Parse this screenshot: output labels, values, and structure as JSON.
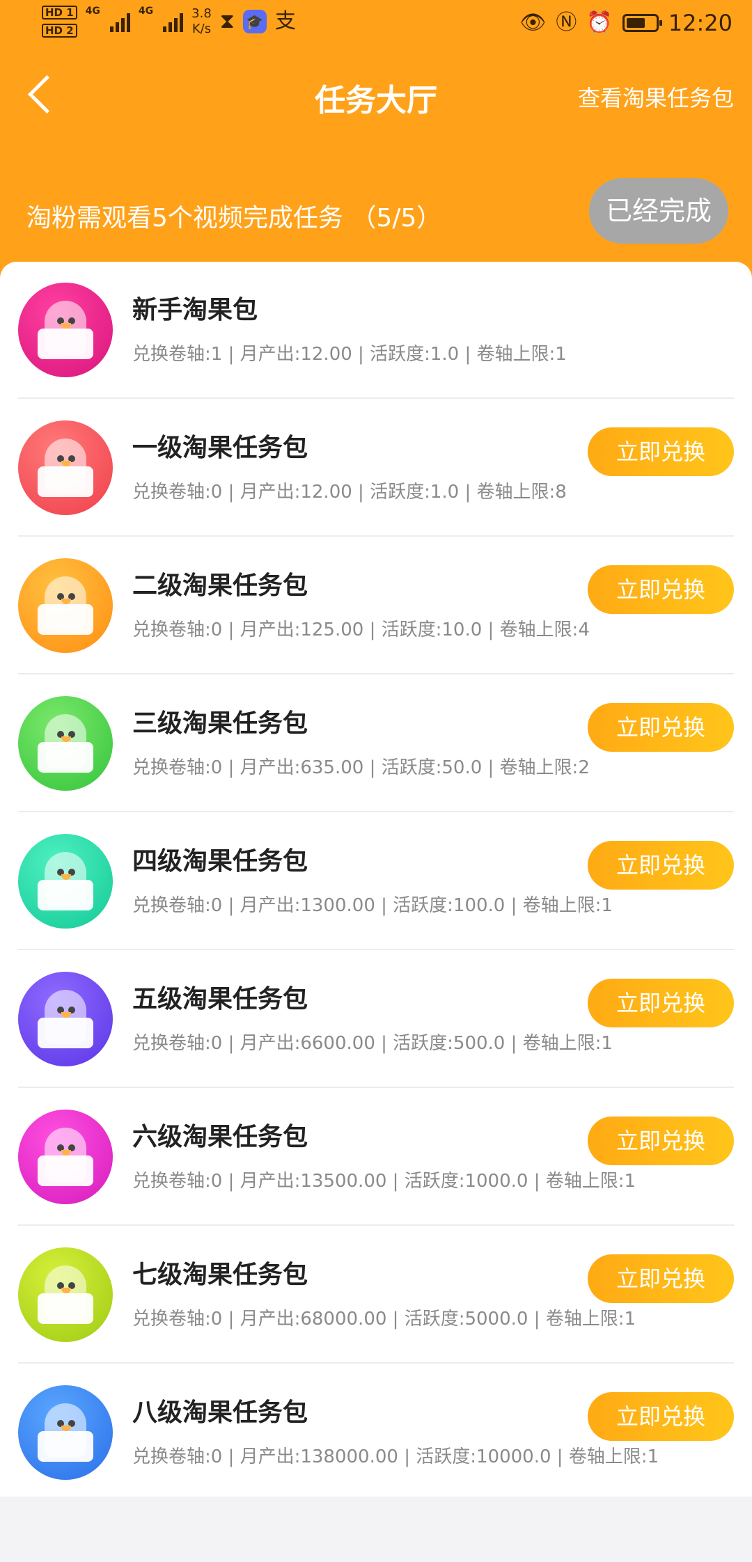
{
  "statusbar": {
    "hd1": "HD 1",
    "hd2": "HD 2",
    "net1": "4G",
    "net2": "4G",
    "speed_value": "3.8",
    "speed_unit": "K/s",
    "time": "12:20"
  },
  "header": {
    "title": "任务大厅",
    "link_label": "查看淘果任务包",
    "task_text": "淘粉需观看5个视频完成任务 （5/5）",
    "task_status": "已经完成"
  },
  "packages": [
    {
      "name": "新手淘果包",
      "info": "兑换卷轴:1 | 月产出:12.00 | 活跃度:1.0 | 卷轴上限:1",
      "button": "",
      "color_a": "#ff3fa0",
      "color_b": "#d9157c"
    },
    {
      "name": "一级淘果任务包",
      "info": "兑换卷轴:0 | 月产出:12.00 | 活跃度:1.0 | 卷轴上限:8",
      "button": "立即兑换",
      "color_a": "#ff7a7a",
      "color_b": "#f03e4a"
    },
    {
      "name": "二级淘果任务包",
      "info": "兑换卷轴:0 | 月产出:125.00 | 活跃度:10.0 | 卷轴上限:4",
      "button": "立即兑换",
      "color_a": "#ffc040",
      "color_b": "#ff8e12"
    },
    {
      "name": "三级淘果任务包",
      "info": "兑换卷轴:0 | 月产出:635.00 | 活跃度:50.0 | 卷轴上限:2",
      "button": "立即兑换",
      "color_a": "#7be86a",
      "color_b": "#34c43c"
    },
    {
      "name": "四级淘果任务包",
      "info": "兑换卷轴:0 | 月产出:1300.00 | 活跃度:100.0 | 卷轴上限:1",
      "button": "立即兑换",
      "color_a": "#4ff0c0",
      "color_b": "#13c997"
    },
    {
      "name": "五级淘果任务包",
      "info": "兑换卷轴:0 | 月产出:6600.00 | 活跃度:500.0 | 卷轴上限:1",
      "button": "立即兑换",
      "color_a": "#8f6bff",
      "color_b": "#5b34e6"
    },
    {
      "name": "六级淘果任务包",
      "info": "兑换卷轴:0 | 月产出:13500.00 | 活跃度:1000.0 | 卷轴上限:1",
      "button": "立即兑换",
      "color_a": "#ff4fe0",
      "color_b": "#d61bbd"
    },
    {
      "name": "七级淘果任务包",
      "info": "兑换卷轴:0 | 月产出:68000.00 | 活跃度:5000.0 | 卷轴上限:1",
      "button": "立即兑换",
      "color_a": "#d6ef3a",
      "color_b": "#9fcb14"
    },
    {
      "name": "八级淘果任务包",
      "info": "兑换卷轴:0 | 月产出:138000.00 | 活跃度:10000.0 | 卷轴上限:1",
      "button": "立即兑换",
      "color_a": "#5aa6ff",
      "color_b": "#2a6fe8"
    }
  ],
  "colors": {
    "brand": "#ffa21a",
    "button_gradient_start": "#ffaa14",
    "button_gradient_end": "#ffc51a",
    "done_button": "#a7a7a7"
  }
}
